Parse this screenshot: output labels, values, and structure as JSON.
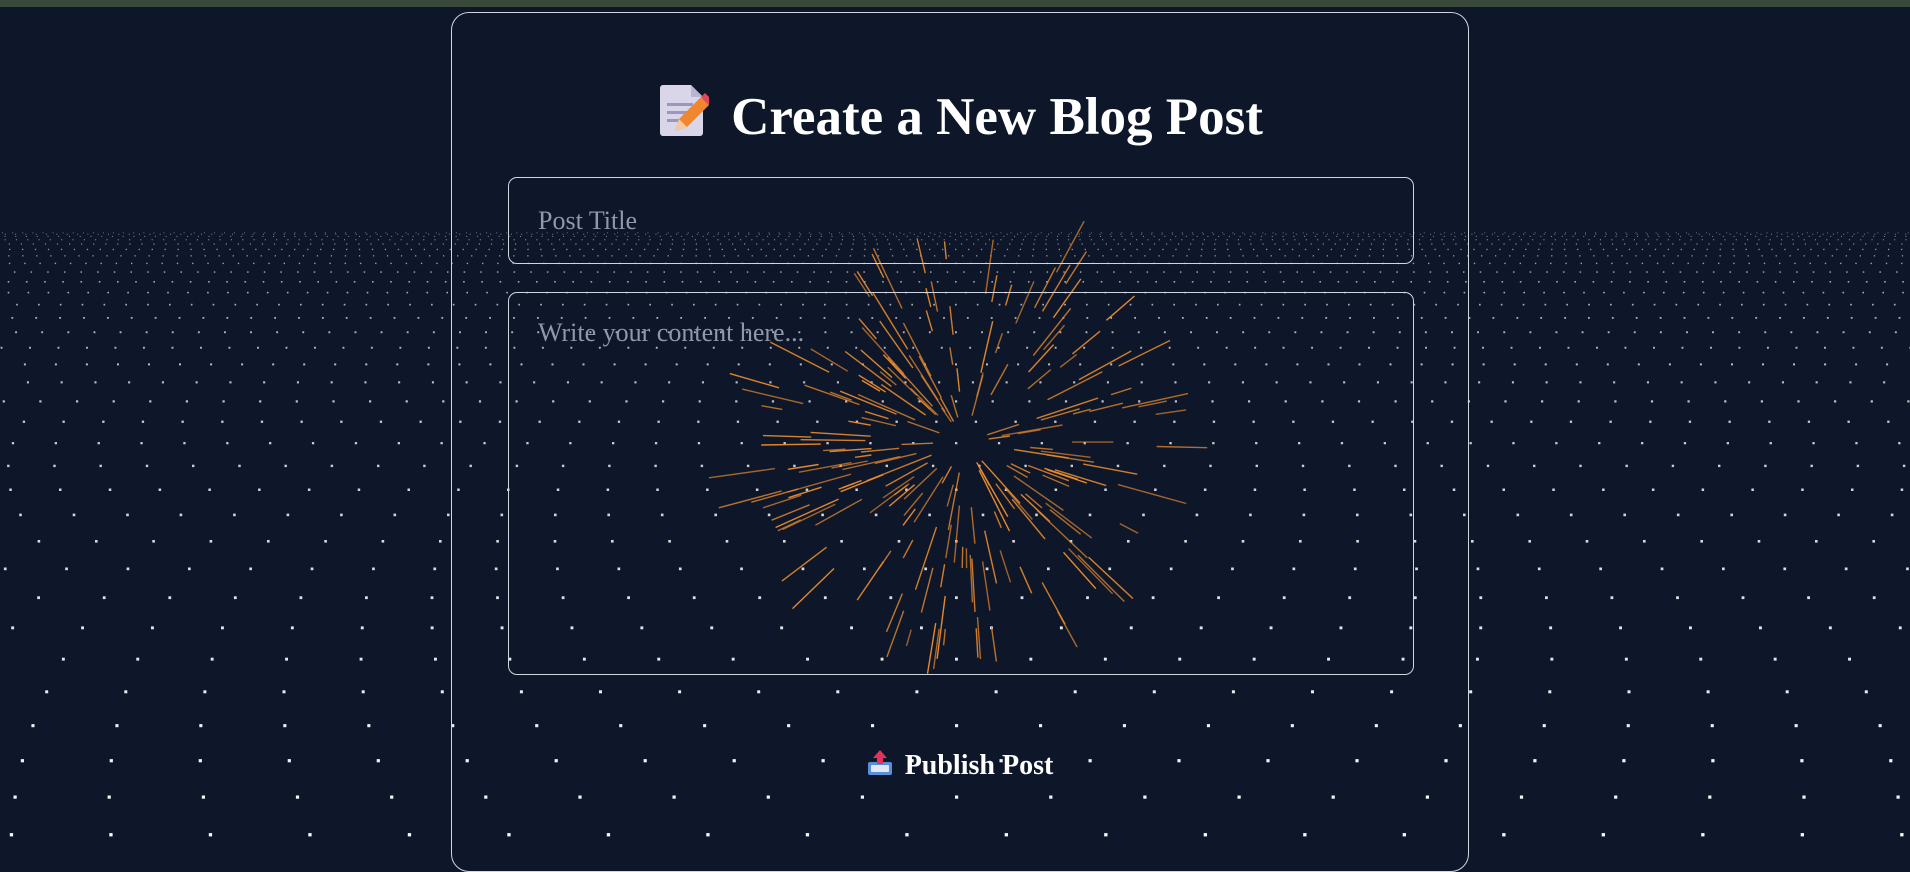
{
  "page": {
    "heading": "Create a New Blog Post",
    "heading_icon": "memo-pencil-icon"
  },
  "form": {
    "title_placeholder": "Post Title",
    "title_value": "",
    "content_placeholder": "Write your content here...",
    "content_value": "",
    "publish_label": "Publish Post",
    "publish_icon": "outbox-tray-icon"
  },
  "colors": {
    "background": "#0e1729",
    "card_border": "#cfd6e0",
    "particle_dots": "#ffffff",
    "burst_lines": "#e88a2e",
    "text": "#ffffff",
    "placeholder": "#8e99ab"
  }
}
